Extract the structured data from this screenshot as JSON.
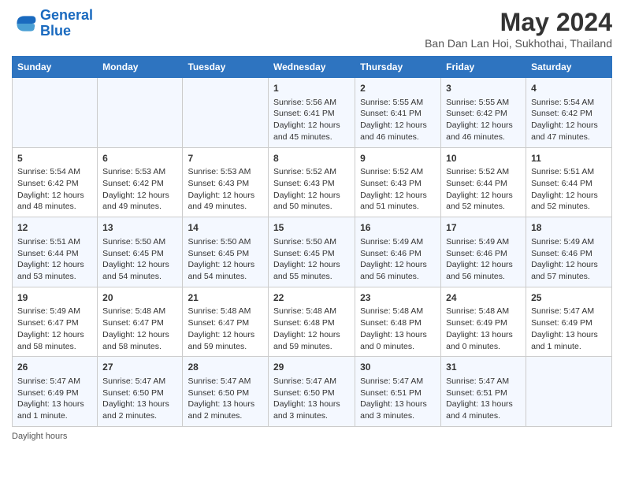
{
  "logo": {
    "text_general": "General",
    "text_blue": "Blue"
  },
  "title": "May 2024",
  "subtitle": "Ban Dan Lan Hoi, Sukhothai, Thailand",
  "days_header": [
    "Sunday",
    "Monday",
    "Tuesday",
    "Wednesday",
    "Thursday",
    "Friday",
    "Saturday"
  ],
  "weeks": [
    [
      {
        "num": "",
        "info": ""
      },
      {
        "num": "",
        "info": ""
      },
      {
        "num": "",
        "info": ""
      },
      {
        "num": "1",
        "info": "Sunrise: 5:56 AM\nSunset: 6:41 PM\nDaylight: 12 hours and 45 minutes."
      },
      {
        "num": "2",
        "info": "Sunrise: 5:55 AM\nSunset: 6:41 PM\nDaylight: 12 hours and 46 minutes."
      },
      {
        "num": "3",
        "info": "Sunrise: 5:55 AM\nSunset: 6:42 PM\nDaylight: 12 hours and 46 minutes."
      },
      {
        "num": "4",
        "info": "Sunrise: 5:54 AM\nSunset: 6:42 PM\nDaylight: 12 hours and 47 minutes."
      }
    ],
    [
      {
        "num": "5",
        "info": "Sunrise: 5:54 AM\nSunset: 6:42 PM\nDaylight: 12 hours and 48 minutes."
      },
      {
        "num": "6",
        "info": "Sunrise: 5:53 AM\nSunset: 6:42 PM\nDaylight: 12 hours and 49 minutes."
      },
      {
        "num": "7",
        "info": "Sunrise: 5:53 AM\nSunset: 6:43 PM\nDaylight: 12 hours and 49 minutes."
      },
      {
        "num": "8",
        "info": "Sunrise: 5:52 AM\nSunset: 6:43 PM\nDaylight: 12 hours and 50 minutes."
      },
      {
        "num": "9",
        "info": "Sunrise: 5:52 AM\nSunset: 6:43 PM\nDaylight: 12 hours and 51 minutes."
      },
      {
        "num": "10",
        "info": "Sunrise: 5:52 AM\nSunset: 6:44 PM\nDaylight: 12 hours and 52 minutes."
      },
      {
        "num": "11",
        "info": "Sunrise: 5:51 AM\nSunset: 6:44 PM\nDaylight: 12 hours and 52 minutes."
      }
    ],
    [
      {
        "num": "12",
        "info": "Sunrise: 5:51 AM\nSunset: 6:44 PM\nDaylight: 12 hours and 53 minutes."
      },
      {
        "num": "13",
        "info": "Sunrise: 5:50 AM\nSunset: 6:45 PM\nDaylight: 12 hours and 54 minutes."
      },
      {
        "num": "14",
        "info": "Sunrise: 5:50 AM\nSunset: 6:45 PM\nDaylight: 12 hours and 54 minutes."
      },
      {
        "num": "15",
        "info": "Sunrise: 5:50 AM\nSunset: 6:45 PM\nDaylight: 12 hours and 55 minutes."
      },
      {
        "num": "16",
        "info": "Sunrise: 5:49 AM\nSunset: 6:46 PM\nDaylight: 12 hours and 56 minutes."
      },
      {
        "num": "17",
        "info": "Sunrise: 5:49 AM\nSunset: 6:46 PM\nDaylight: 12 hours and 56 minutes."
      },
      {
        "num": "18",
        "info": "Sunrise: 5:49 AM\nSunset: 6:46 PM\nDaylight: 12 hours and 57 minutes."
      }
    ],
    [
      {
        "num": "19",
        "info": "Sunrise: 5:49 AM\nSunset: 6:47 PM\nDaylight: 12 hours and 58 minutes."
      },
      {
        "num": "20",
        "info": "Sunrise: 5:48 AM\nSunset: 6:47 PM\nDaylight: 12 hours and 58 minutes."
      },
      {
        "num": "21",
        "info": "Sunrise: 5:48 AM\nSunset: 6:47 PM\nDaylight: 12 hours and 59 minutes."
      },
      {
        "num": "22",
        "info": "Sunrise: 5:48 AM\nSunset: 6:48 PM\nDaylight: 12 hours and 59 minutes."
      },
      {
        "num": "23",
        "info": "Sunrise: 5:48 AM\nSunset: 6:48 PM\nDaylight: 13 hours and 0 minutes."
      },
      {
        "num": "24",
        "info": "Sunrise: 5:48 AM\nSunset: 6:49 PM\nDaylight: 13 hours and 0 minutes."
      },
      {
        "num": "25",
        "info": "Sunrise: 5:47 AM\nSunset: 6:49 PM\nDaylight: 13 hours and 1 minute."
      }
    ],
    [
      {
        "num": "26",
        "info": "Sunrise: 5:47 AM\nSunset: 6:49 PM\nDaylight: 13 hours and 1 minute."
      },
      {
        "num": "27",
        "info": "Sunrise: 5:47 AM\nSunset: 6:50 PM\nDaylight: 13 hours and 2 minutes."
      },
      {
        "num": "28",
        "info": "Sunrise: 5:47 AM\nSunset: 6:50 PM\nDaylight: 13 hours and 2 minutes."
      },
      {
        "num": "29",
        "info": "Sunrise: 5:47 AM\nSunset: 6:50 PM\nDaylight: 13 hours and 3 minutes."
      },
      {
        "num": "30",
        "info": "Sunrise: 5:47 AM\nSunset: 6:51 PM\nDaylight: 13 hours and 3 minutes."
      },
      {
        "num": "31",
        "info": "Sunrise: 5:47 AM\nSunset: 6:51 PM\nDaylight: 13 hours and 4 minutes."
      },
      {
        "num": "",
        "info": ""
      }
    ]
  ],
  "footer": {
    "daylight_label": "Daylight hours"
  }
}
